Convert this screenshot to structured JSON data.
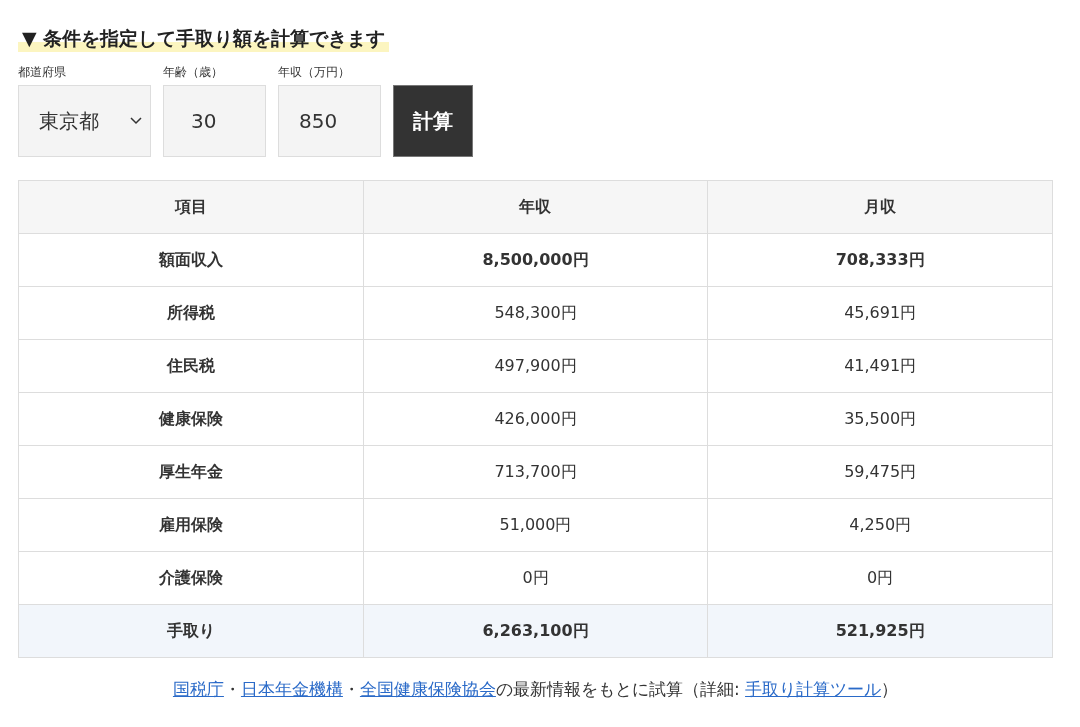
{
  "heading": {
    "marker": "▼",
    "title": "条件を指定して手取り額を計算できます"
  },
  "form": {
    "prefecture": {
      "label": "都道府県",
      "value": "東京都"
    },
    "age": {
      "label": "年齢（歳）",
      "value": "30"
    },
    "income": {
      "label": "年収（万円）",
      "value": "850"
    },
    "button": "計算"
  },
  "table": {
    "columns": [
      "項目",
      "年収",
      "月収"
    ],
    "rows": [
      {
        "kind": "strong",
        "cells": [
          "額面収入",
          "8,500,000円",
          "708,333円"
        ]
      },
      {
        "kind": "plain",
        "cells": [
          "所得税",
          "548,300円",
          "45,691円"
        ]
      },
      {
        "kind": "plain",
        "cells": [
          "住民税",
          "497,900円",
          "41,491円"
        ]
      },
      {
        "kind": "plain",
        "cells": [
          "健康保険",
          "426,000円",
          "35,500円"
        ]
      },
      {
        "kind": "plain",
        "cells": [
          "厚生年金",
          "713,700円",
          "59,475円"
        ]
      },
      {
        "kind": "plain",
        "cells": [
          "雇用保険",
          "51,000円",
          "4,250円"
        ]
      },
      {
        "kind": "plain",
        "cells": [
          "介護保険",
          "0円",
          "0円"
        ]
      },
      {
        "kind": "total",
        "cells": [
          "手取り",
          "6,263,100円",
          "521,925円"
        ]
      }
    ]
  },
  "footer": [
    {
      "kind": "link",
      "text": "国税庁"
    },
    {
      "kind": "text",
      "text": "・"
    },
    {
      "kind": "link",
      "text": "日本年金機構"
    },
    {
      "kind": "text",
      "text": "・"
    },
    {
      "kind": "link",
      "text": "全国健康保険協会"
    },
    {
      "kind": "text",
      "text": "の最新情報をもとに試算（詳細: "
    },
    {
      "kind": "link",
      "text": "手取り計算ツール"
    },
    {
      "kind": "text",
      "text": "）"
    }
  ]
}
